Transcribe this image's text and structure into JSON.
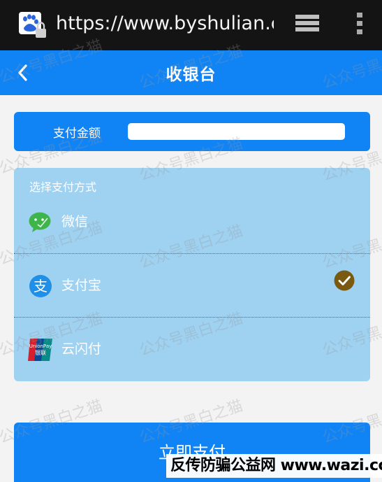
{
  "browser": {
    "url": "https://www.byshulian.com",
    "site_icon": "baidu-paw-lock-icon",
    "tabs_icon": "tabs-stack-icon",
    "menu_icon": "overflow-menu-icon"
  },
  "header": {
    "title": "收银台",
    "back_icon": "chevron-left-icon"
  },
  "amount": {
    "label": "支付金额",
    "value": "",
    "placeholder": ""
  },
  "methods": {
    "heading": "选择支付方式",
    "items": [
      {
        "label": "微信",
        "icon": "wechat-icon",
        "selected": false
      },
      {
        "label": "支付宝",
        "icon": "alipay-icon",
        "selected": true
      },
      {
        "label": "云闪付",
        "icon": "unionpay-icon",
        "selected": false
      }
    ]
  },
  "pay_button": {
    "label": "立即支付"
  },
  "watermark": {
    "text": "公众号黑白之猫"
  },
  "footer": {
    "text": "反传防骗公益网 www.wazi.cc"
  },
  "colors": {
    "primary": "#1184f5",
    "card": "#9fd1f1",
    "browser_bar": "#141414",
    "check": "#7a5a10",
    "wechat": "#3db54a",
    "alipay": "#1f8fe8"
  }
}
